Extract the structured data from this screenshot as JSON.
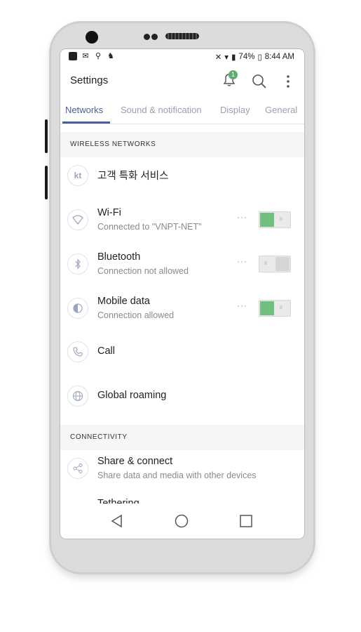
{
  "status_bar": {
    "battery": "74%",
    "time": "8:44 AM"
  },
  "app_bar": {
    "title": "Settings",
    "notification_count": "1"
  },
  "tabs": [
    {
      "label": "Networks",
      "active": true
    },
    {
      "label": "Sound & notification",
      "active": false
    },
    {
      "label": "Display",
      "active": false
    },
    {
      "label": "General",
      "active": false
    }
  ],
  "sections": {
    "wireless": "WIRELESS NETWORKS",
    "connectivity": "CONNECTIVITY"
  },
  "items": {
    "kt": {
      "icon": "kt",
      "title": "고객 특화 서비스"
    },
    "wifi": {
      "title": "Wi-Fi",
      "subtitle": "Connected to \"VNPT-NET\"",
      "toggle": "on"
    },
    "bluetooth": {
      "title": "Bluetooth",
      "subtitle": "Connection not allowed",
      "toggle": "off"
    },
    "mobile_data": {
      "title": "Mobile data",
      "subtitle": "Connection allowed",
      "toggle": "on"
    },
    "call": {
      "title": "Call"
    },
    "global_roaming": {
      "title": "Global roaming"
    },
    "share_connect": {
      "title": "Share & connect",
      "subtitle": "Share data and media with other devices"
    },
    "tethering": {
      "title": "Tethering"
    }
  },
  "colors": {
    "accent": "#4b5f9a",
    "toggle_on": "#6fbf7f",
    "badge": "#5cae6e"
  }
}
